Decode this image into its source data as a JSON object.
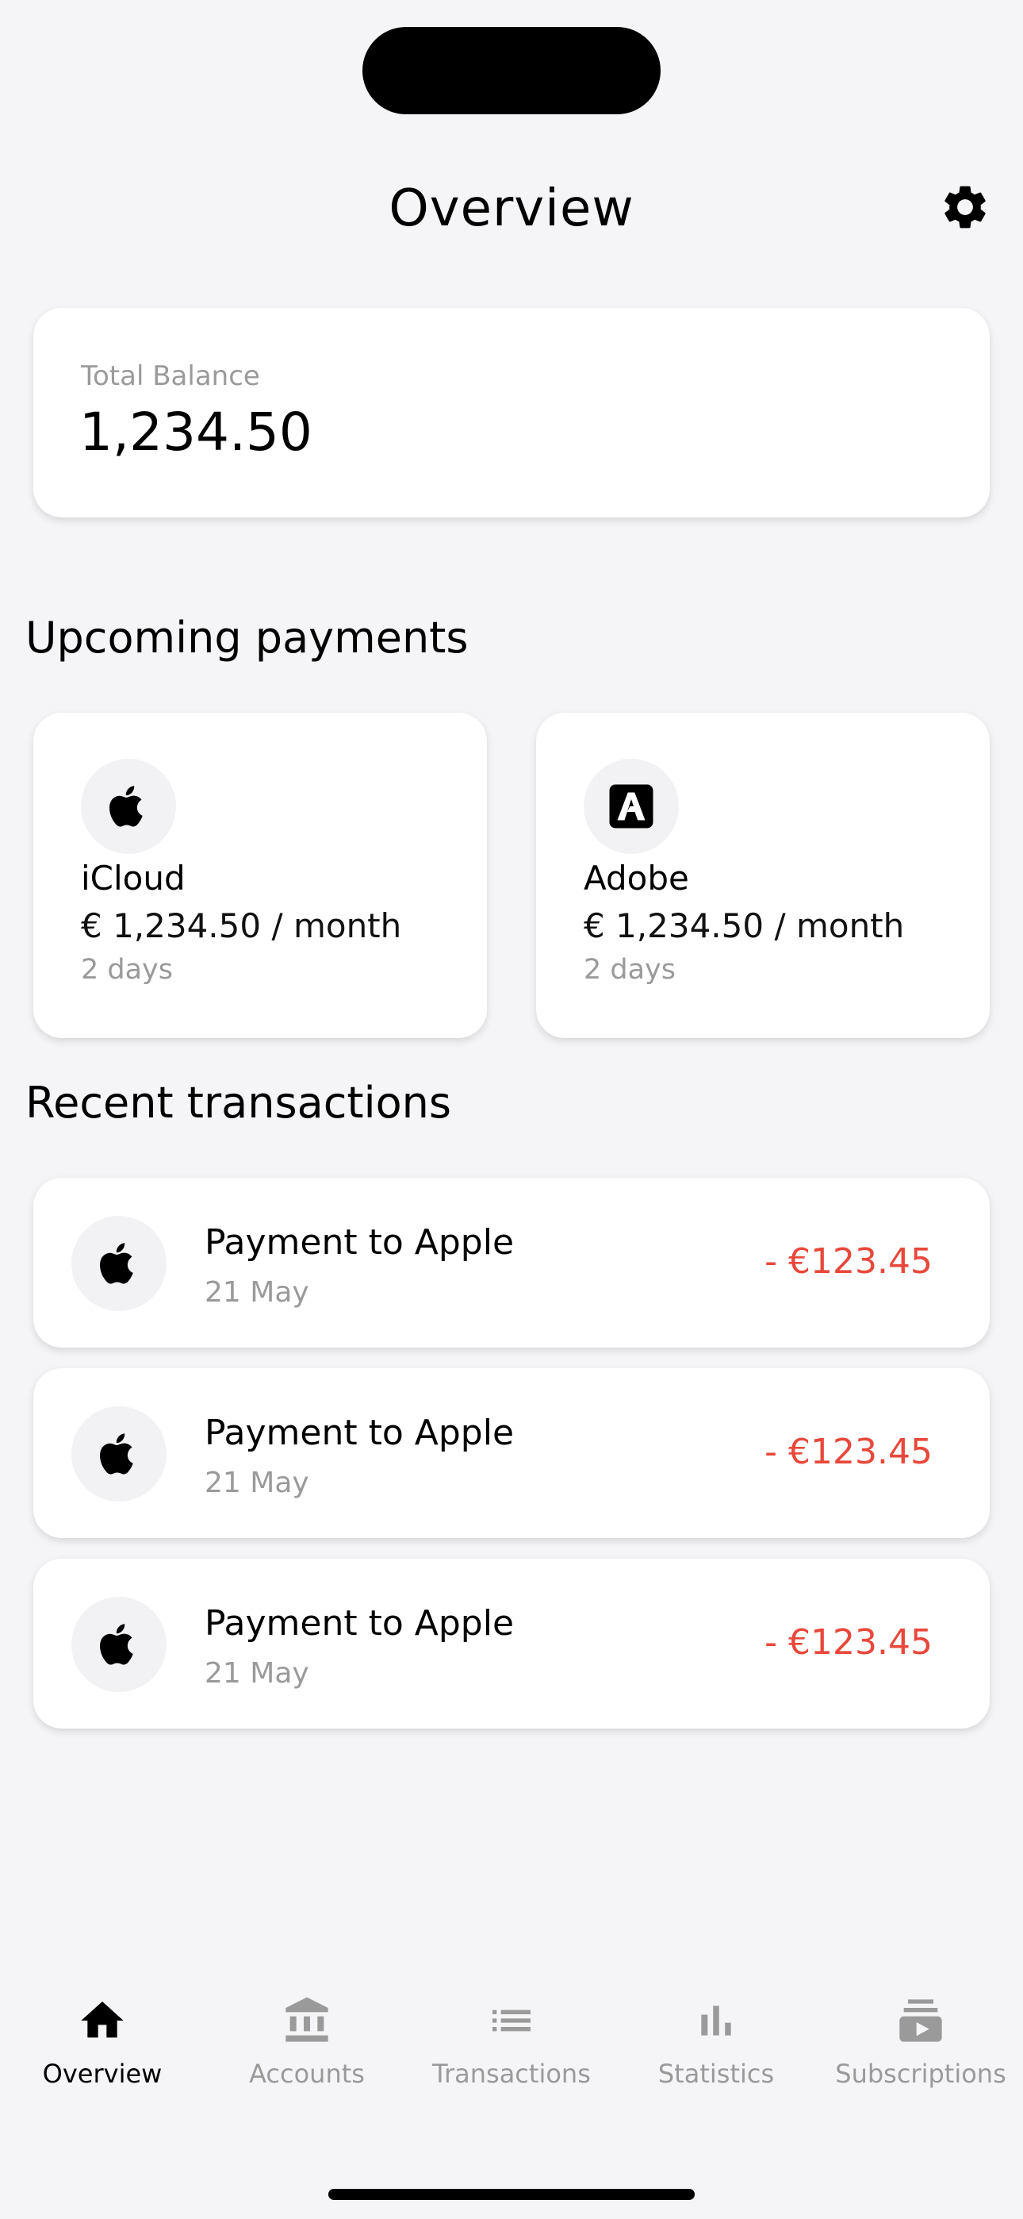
{
  "header": {
    "title": "Overview"
  },
  "balance": {
    "label": "Total Balance",
    "value": "1,234.50"
  },
  "upcoming": {
    "title": "Upcoming payments",
    "items": [
      {
        "name": "iCloud",
        "amount": "€ 1,234.50 / month",
        "due": "2 days",
        "icon": "apple-icon"
      },
      {
        "name": "Adobe",
        "amount": "€ 1,234.50 / month",
        "due": "2 days",
        "icon": "adobe-icon"
      }
    ]
  },
  "recent": {
    "title": "Recent transactions",
    "items": [
      {
        "description": "Payment to Apple",
        "date": "21 May",
        "amount": "- €123.45",
        "icon": "apple-icon"
      },
      {
        "description": "Payment to Apple",
        "date": "21 May",
        "amount": "- €123.45",
        "icon": "apple-icon"
      },
      {
        "description": "Payment to Apple",
        "date": "21 May",
        "amount": "- €123.45",
        "icon": "apple-icon"
      }
    ]
  },
  "nav": {
    "items": [
      {
        "label": "Overview",
        "icon": "home-icon",
        "active": true
      },
      {
        "label": "Accounts",
        "icon": "bank-icon",
        "active": false
      },
      {
        "label": "Transactions",
        "icon": "list-icon",
        "active": false
      },
      {
        "label": "Statistics",
        "icon": "bar-chart-icon",
        "active": false
      },
      {
        "label": "Subscriptions",
        "icon": "subscriptions-icon",
        "active": false
      }
    ]
  },
  "colors": {
    "negative_amount": "#e8483b",
    "inactive": "#9a9a9a",
    "background": "#f5f5f7"
  }
}
